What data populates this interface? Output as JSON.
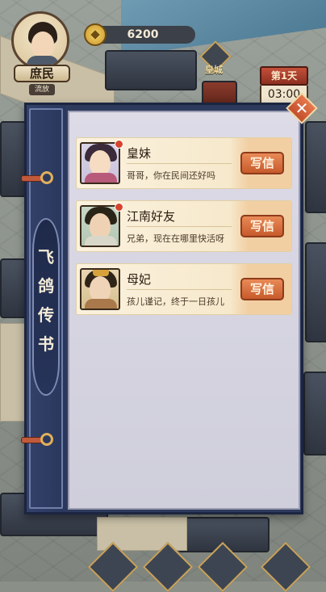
{
  "hud": {
    "rank": "庶民",
    "sub_tag": "流放",
    "coins": "6200",
    "palace_label": "皇城",
    "day": "第1天",
    "time": "03:00"
  },
  "dialog": {
    "title_chars": [
      "飞",
      "鸽",
      "传",
      "书"
    ],
    "letters": [
      {
        "name": "皇妹",
        "message": "哥哥，你在民间还好吗",
        "button": "写信",
        "unread": true
      },
      {
        "name": "江南好友",
        "message": "兄弟，现在在哪里快活呀",
        "button": "写信",
        "unread": true
      },
      {
        "name": "母妃",
        "message": "孩儿谨记，终于一日孩儿",
        "button": "写信",
        "unread": false
      }
    ]
  },
  "colors": {
    "panel": "#2d3a5c",
    "accent": "#c75a2c",
    "paper": "#fbf2de"
  }
}
